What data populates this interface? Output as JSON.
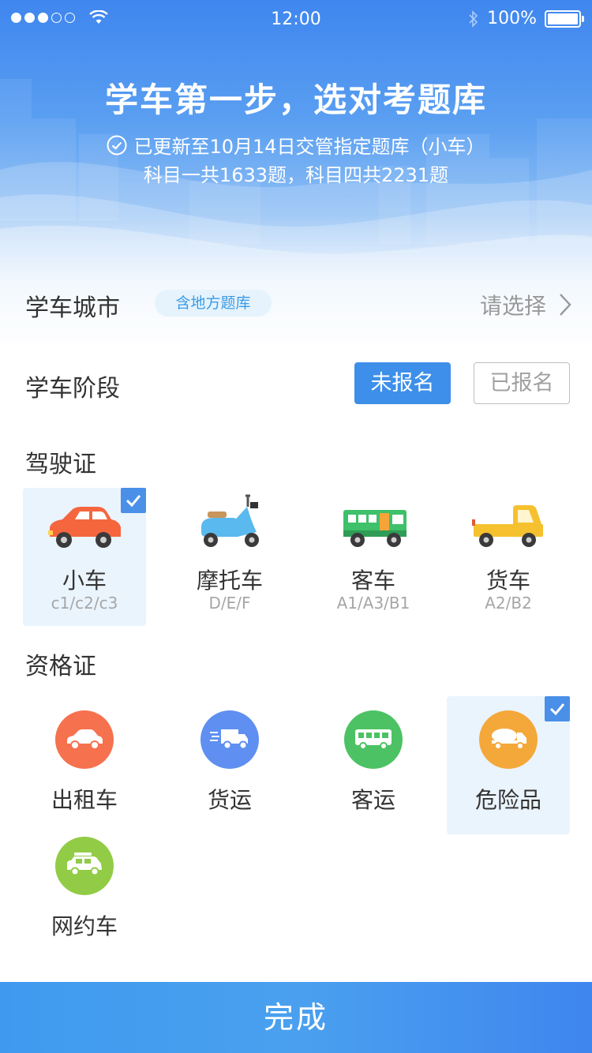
{
  "status_bar": {
    "time": "12:00",
    "battery": "100%"
  },
  "hero": {
    "title": "学车第一步，选对考题库",
    "update_line": "已更新至10月14日交管指定题库（小车）",
    "count_line": "科目一共1633题，科目四共2231题"
  },
  "city": {
    "label": "学车城市",
    "tag": "含地方题库",
    "value": "请选择"
  },
  "stage": {
    "label": "学车阶段",
    "options": [
      "未报名",
      "已报名"
    ],
    "selected": "未报名"
  },
  "license": {
    "section_title": "驾驶证",
    "items": [
      {
        "name": "小车",
        "code": "c1/c2/c3",
        "icon": "car-icon",
        "selected": true
      },
      {
        "name": "摩托车",
        "code": "D/E/F",
        "icon": "motorcycle-icon",
        "selected": false
      },
      {
        "name": "客车",
        "code": "A1/A3/B1",
        "icon": "bus-icon",
        "selected": false
      },
      {
        "name": "货车",
        "code": "A2/B2",
        "icon": "truck-icon",
        "selected": false
      }
    ]
  },
  "qualification": {
    "section_title": "资格证",
    "items": [
      {
        "name": "出租车",
        "icon": "taxi-icon",
        "color": "#f6714e",
        "selected": false
      },
      {
        "name": "货运",
        "icon": "freight-truck-icon",
        "color": "#5f8ff0",
        "selected": false
      },
      {
        "name": "客运",
        "icon": "coach-bus-icon",
        "color": "#4cc264",
        "selected": false
      },
      {
        "name": "危险品",
        "icon": "tanker-truck-icon",
        "color": "#f4a83a",
        "selected": true
      },
      {
        "name": "网约车",
        "icon": "suv-icon",
        "color": "#92cc46",
        "selected": false
      }
    ]
  },
  "footer": {
    "done_label": "完成"
  },
  "colors": {
    "primary": "#3d8fe9",
    "selected_bg": "#eaf4fd",
    "tag_text": "#3a9be8"
  }
}
